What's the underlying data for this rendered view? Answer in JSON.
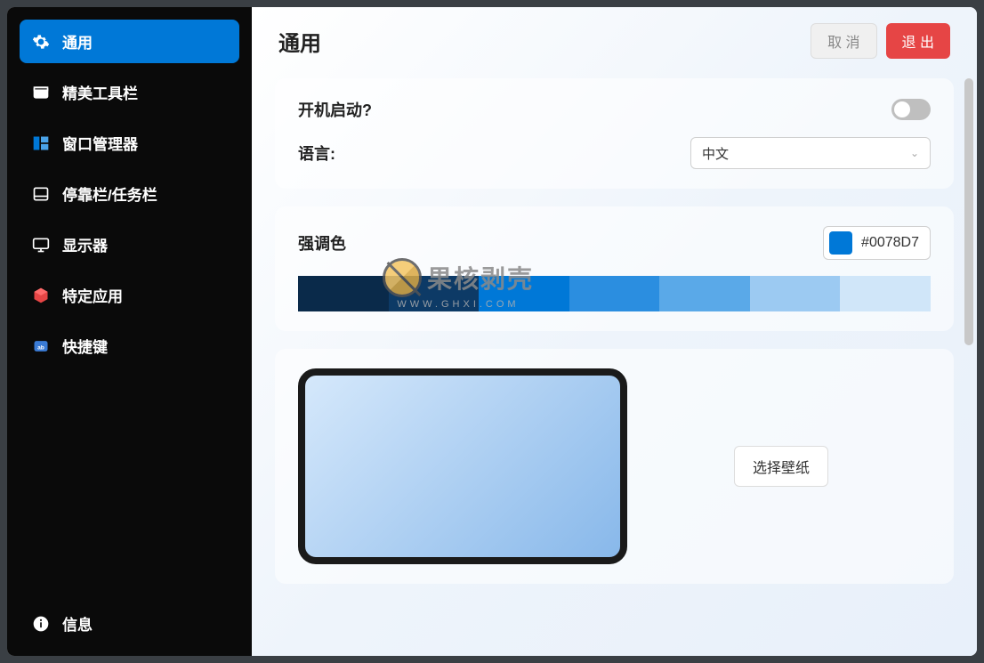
{
  "sidebar": {
    "items": [
      {
        "label": "通用",
        "icon": "gear-icon",
        "active": true
      },
      {
        "label": "精美工具栏",
        "icon": "toolbar-icon"
      },
      {
        "label": "窗口管理器",
        "icon": "window-manager-icon"
      },
      {
        "label": "停靠栏/任务栏",
        "icon": "dock-icon"
      },
      {
        "label": "显示器",
        "icon": "monitor-icon"
      },
      {
        "label": "特定应用",
        "icon": "apps-icon"
      },
      {
        "label": "快捷键",
        "icon": "shortcut-icon"
      }
    ],
    "footer": {
      "label": "信息",
      "icon": "info-icon"
    }
  },
  "header": {
    "title": "通用",
    "cancel": "取 消",
    "exit": "退 出"
  },
  "general": {
    "startup_label": "开机启动?",
    "startup_enabled": false,
    "language_label": "语言:",
    "language_value": "中文"
  },
  "accent": {
    "label": "强调色",
    "hex": "#0078D7",
    "palette": [
      "#0a2a4a",
      "#0d3a66",
      "#0078d7",
      "#2b8ee0",
      "#5aa9e8",
      "#9ccaf2",
      "#d0e6f9"
    ]
  },
  "wallpaper": {
    "choose": "选择壁纸"
  },
  "watermark": {
    "text": "果核剥壳",
    "sub": "WWW.GHXI.COM"
  }
}
